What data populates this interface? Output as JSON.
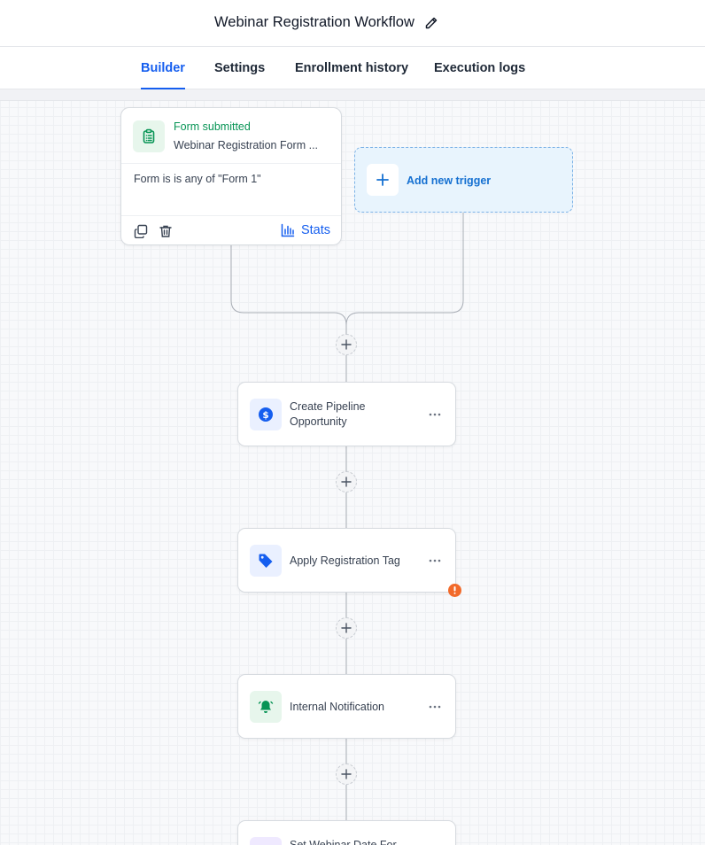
{
  "header": {
    "title": "Webinar Registration Workflow",
    "edit_icon": "pencil-icon"
  },
  "tabs": [
    {
      "label": "Builder",
      "active": true
    },
    {
      "label": "Settings",
      "active": false
    },
    {
      "label": "Enrollment history",
      "active": false
    },
    {
      "label": "Execution logs",
      "active": false
    }
  ],
  "trigger": {
    "type": "Form submitted",
    "name": "Webinar Registration Form ...",
    "condition": "Form is is any of \"Form 1\"",
    "icon": "clipboard-list-icon",
    "copy_icon": "copy-icon",
    "delete_icon": "trash-icon",
    "stats_icon": "bar-chart-icon",
    "stats_label": "Stats"
  },
  "add_trigger": {
    "label": "Add new trigger",
    "icon": "plus-icon"
  },
  "actions": [
    {
      "label": "Create Pipeline Opportunity",
      "label_line1": "Create Pipeline",
      "label_line2": "Opportunity",
      "icon": "dollar-circle-icon"
    },
    {
      "label": "Apply Registration Tag",
      "icon": "tag-icon",
      "warning": true
    },
    {
      "label": "Internal Notification",
      "icon": "bell-icon"
    },
    {
      "label": "Set Webinar Date For...",
      "icon": "calendar-icon"
    }
  ],
  "colors": {
    "accent": "#155eef",
    "trigger_green": "#079455",
    "warning": "#f26a2a",
    "canvas_bg": "#f8f9fb"
  }
}
